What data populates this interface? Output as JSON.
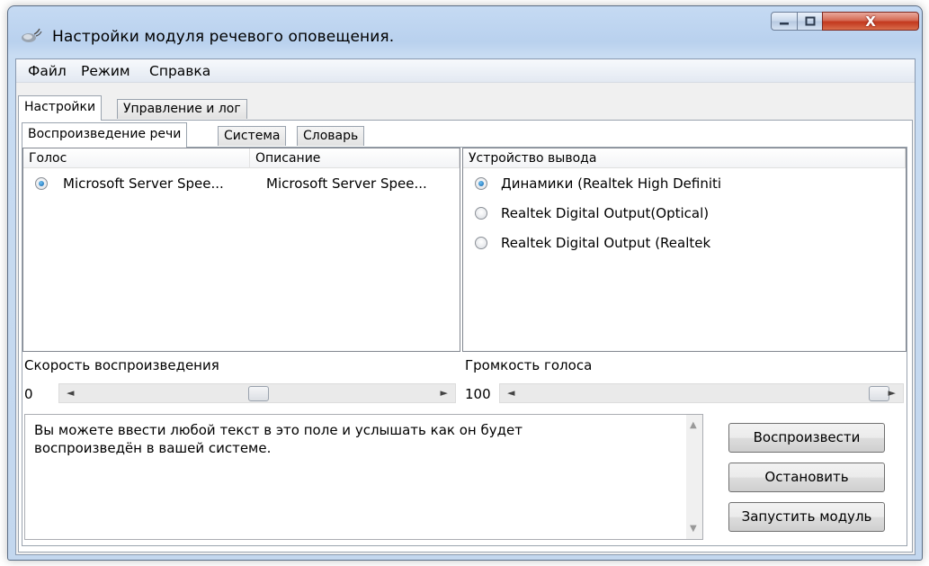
{
  "window": {
    "title": "Настройки модуля речевого оповещения.",
    "close_label": "X"
  },
  "menu": [
    "Файл",
    "Режим",
    "Справка"
  ],
  "top_tabs": [
    "Настройки",
    "Управление и лог"
  ],
  "sub_tabs": [
    "Воспроизведение речи",
    "Система",
    "Словарь"
  ],
  "voices": {
    "columns": [
      "Голос",
      "Описание"
    ],
    "rows": [
      {
        "name": "Microsoft Server Spee...",
        "description": "Microsoft Server Spee...",
        "selected": true
      }
    ]
  },
  "output": {
    "header": "Устройство вывода",
    "devices": [
      {
        "label": "Динамики (Realtek High Definiti",
        "selected": true
      },
      {
        "label": "Realtek Digital Output(Optical)",
        "selected": false
      },
      {
        "label": "Realtek Digital Output (Realtek",
        "selected": false
      }
    ]
  },
  "speed": {
    "label": "Скорость воспроизведения",
    "value": "0",
    "position": 0.5
  },
  "volume": {
    "label": "Громкость голоса",
    "value": "100",
    "position": 1.0
  },
  "text_input": {
    "value": "Вы можете ввести любой текст в это поле и услышать как он будет воспроизведён в вашей системе."
  },
  "buttons": {
    "play": "Воспроизвести",
    "stop": "Остановить",
    "start_module": "Запустить модуль"
  }
}
